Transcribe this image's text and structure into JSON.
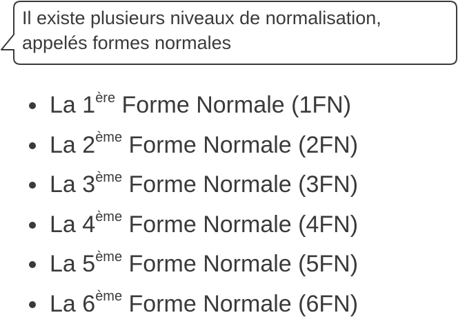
{
  "callout": {
    "line1": "Il existe plusieurs niveaux de normalisation,",
    "line2": "appelés formes normales"
  },
  "items": [
    {
      "prefix": "La 1",
      "sup": "ère",
      "suffix": " Forme Normale (1FN)"
    },
    {
      "prefix": "La 2",
      "sup": "ème",
      "suffix": " Forme Normale (2FN)"
    },
    {
      "prefix": "La 3",
      "sup": "ème",
      "suffix": " Forme Normale (3FN)"
    },
    {
      "prefix": "La 4",
      "sup": "ème",
      "suffix": " Forme Normale (4FN)"
    },
    {
      "prefix": "La 5",
      "sup": "ème",
      "suffix": " Forme Normale (5FN)"
    },
    {
      "prefix": "La 6",
      "sup": "ème",
      "suffix": " Forme Normale (6FN)"
    }
  ]
}
